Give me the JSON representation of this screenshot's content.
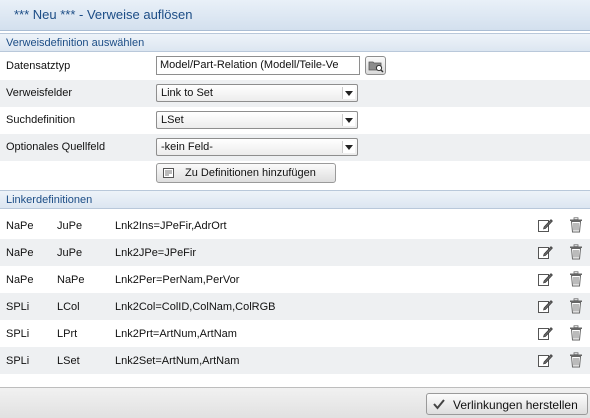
{
  "window": {
    "title": "*** Neu *** - Verweise auflösen"
  },
  "sections": {
    "definition": "Verweisdefinition auswählen",
    "linker": "Linkerdefinitionen"
  },
  "form": {
    "datensatztyp": {
      "label": "Datensatztyp",
      "value": "Model/Part-Relation (Modell/Teile-Ve"
    },
    "verweisfelder": {
      "label": "Verweisfelder",
      "value": "Link to Set"
    },
    "suchdefinition": {
      "label": "Suchdefinition",
      "value": "LSet"
    },
    "quellfeld": {
      "label": "Optionales Quellfeld",
      "value": "-kein Feld-"
    },
    "add_button": "Zu Definitionen hinzufügen"
  },
  "linker_rows": [
    {
      "col1": "NaPe",
      "col2": "JuPe",
      "col3": "Lnk2Ins=JPeFir,AdrOrt"
    },
    {
      "col1": "NaPe",
      "col2": "JuPe",
      "col3": "Lnk2JPe=JPeFir"
    },
    {
      "col1": "NaPe",
      "col2": "NaPe",
      "col3": "Lnk2Per=PerNam,PerVor"
    },
    {
      "col1": "SPLi",
      "col2": "LCol",
      "col3": "Lnk2Col=ColID,ColNam,ColRGB"
    },
    {
      "col1": "SPLi",
      "col2": "LPrt",
      "col3": "Lnk2Prt=ArtNum,ArtNam"
    },
    {
      "col1": "SPLi",
      "col2": "LSet",
      "col3": "Lnk2Set=ArtNum,ArtNam"
    }
  ],
  "footer": {
    "link_button": "Verlinkungen herstellen"
  },
  "icons": {
    "browse": "folder-browse-icon",
    "add": "add-definition-icon",
    "edit": "edit-pencil-icon",
    "delete": "trash-icon",
    "confirm": "checkmark-icon"
  },
  "colors": {
    "accent": "#1c4d86",
    "section_bg": "#dce6f1"
  }
}
